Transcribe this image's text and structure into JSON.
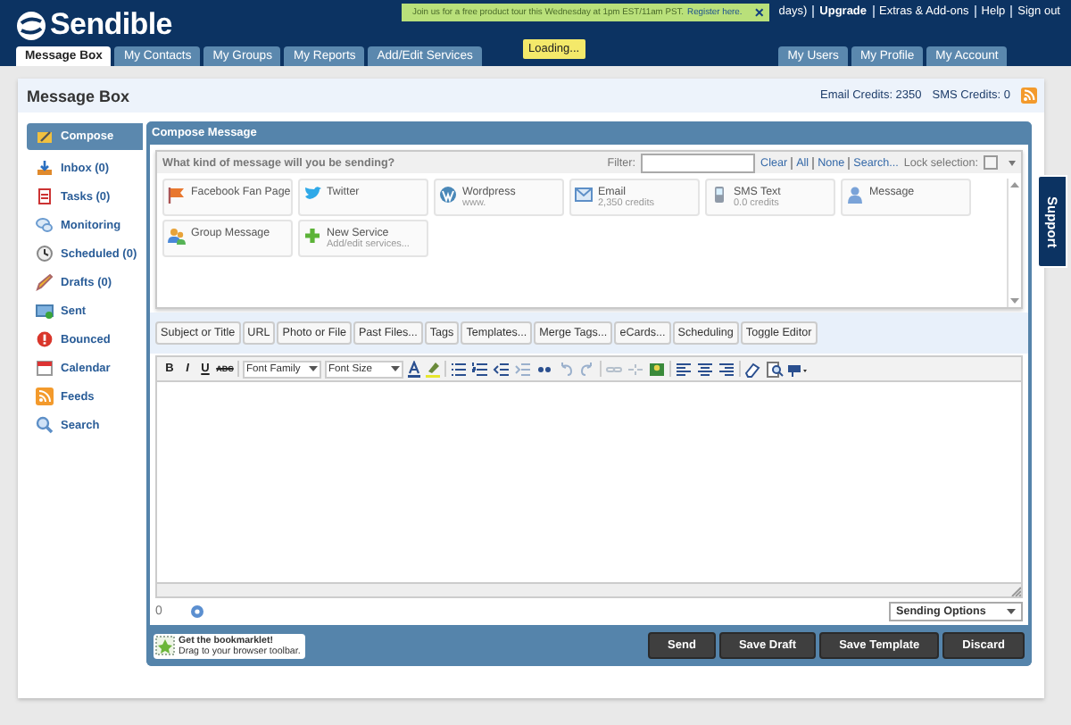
{
  "header": {
    "logo": "Sendible",
    "trial_note": "days)",
    "top_links": [
      "Upgrade",
      "Extras & Add-ons",
      "Help",
      "Sign out"
    ],
    "notice": {
      "text": "Join us for a free product tour this Wednesday at 1pm EST/11am PST.",
      "link": "Register here.",
      "close": "×"
    },
    "loading": "Loading...",
    "tabs_left": [
      {
        "label": "Message Box",
        "selected": true
      },
      {
        "label": "My Contacts",
        "selected": false
      },
      {
        "label": "My Groups",
        "selected": false
      },
      {
        "label": "My Reports",
        "selected": false
      },
      {
        "label": "Add/Edit Services",
        "selected": false
      }
    ],
    "tabs_right": [
      {
        "label": "My Users",
        "selected": false
      },
      {
        "label": "My Profile",
        "selected": false
      },
      {
        "label": "My Account",
        "selected": false
      }
    ]
  },
  "page": {
    "title": "Message Box",
    "email_credits": "Email Credits: 2350",
    "sms_credits": "SMS Credits: 0"
  },
  "sidebar": {
    "items": [
      {
        "label": "Compose",
        "selected": true
      },
      {
        "label": "Inbox (0)",
        "selected": false
      },
      {
        "label": "Tasks (0)",
        "selected": false
      },
      {
        "label": "Monitoring",
        "selected": false
      },
      {
        "label": "Scheduled (0)",
        "selected": false
      },
      {
        "label": "Drafts (0)",
        "selected": false
      },
      {
        "label": "Sent",
        "selected": false
      },
      {
        "label": "Bounced",
        "selected": false
      },
      {
        "label": "Calendar",
        "selected": false
      },
      {
        "label": "Feeds",
        "selected": false
      },
      {
        "label": "Search",
        "selected": false
      }
    ]
  },
  "compose": {
    "title": "Compose Message",
    "chooser": {
      "question": "What kind of message will you be sending?",
      "filter_label": "Filter:",
      "filter_links": [
        "Clear",
        "All",
        "None",
        "Search..."
      ],
      "lock_label": "Lock selection:",
      "lock_checked": false,
      "services": [
        {
          "name": "Facebook Fan Page"
        },
        {
          "name": "Twitter"
        },
        {
          "name": "Wordpress",
          "detail": "www."
        },
        {
          "name": "Email",
          "detail": "2,350 credits"
        },
        {
          "name": "SMS Text",
          "detail": "0.0 credits"
        },
        {
          "name": "Message"
        },
        {
          "name": "Group Message"
        },
        {
          "name": "New Service",
          "detail": "Add/edit services..."
        }
      ]
    },
    "toolbar_tabs": [
      "Subject or Title",
      "URL",
      "Photo or File",
      "Past Files...",
      "Tags",
      "Templates...",
      "Merge Tags...",
      "eCards...",
      "Scheduling",
      "Toggle Editor"
    ],
    "format_buttons": [
      "B",
      "I",
      "U",
      "ABC"
    ],
    "font_family": "Font Family",
    "font_size": "Font Size",
    "char_count": "0",
    "sending_options": "Sending Options",
    "bookmarklet": {
      "title": "Get the bookmarklet!",
      "hint": "Drag to your browser toolbar."
    },
    "actions": [
      "Send",
      "Save Draft",
      "Save Template",
      "Discard"
    ]
  },
  "support_tab": "Support"
}
